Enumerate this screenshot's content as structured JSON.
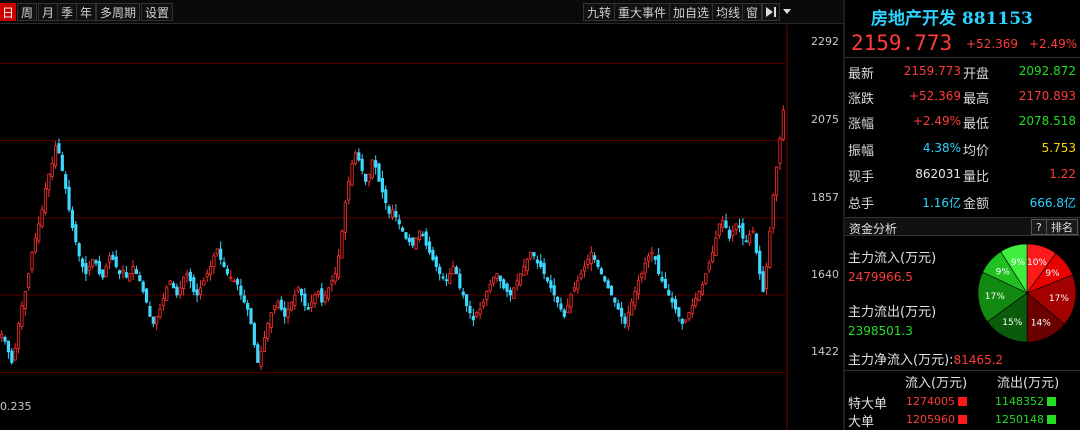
{
  "toolbar": {
    "left": [
      "日",
      "周",
      "月",
      "季",
      "年",
      "多周期",
      "设置"
    ],
    "right": [
      "九转",
      "重大事件",
      "加自选",
      "均线",
      "窗"
    ]
  },
  "chart": {
    "y_labels": [
      "2292",
      "2075",
      "1857",
      "1640",
      "1422"
    ],
    "min_label": "0.235"
  },
  "chart_data": {
    "type": "candlestick",
    "ylim": [
      1260,
      2400
    ],
    "closes": [
      1530,
      1510,
      1480,
      1450,
      1490,
      1560,
      1610,
      1650,
      1700,
      1760,
      1800,
      1840,
      1880,
      1940,
      1980,
      2010,
      2060,
      2040,
      1990,
      1940,
      1880,
      1830,
      1790,
      1750,
      1720,
      1700,
      1720,
      1740,
      1730,
      1700,
      1690,
      1720,
      1750,
      1740,
      1720,
      1700,
      1710,
      1690,
      1700,
      1720,
      1700,
      1680,
      1650,
      1620,
      1580,
      1560,
      1580,
      1600,
      1630,
      1660,
      1680,
      1660,
      1640,
      1660,
      1690,
      1700,
      1680,
      1650,
      1640,
      1660,
      1680,
      1700,
      1720,
      1750,
      1770,
      1740,
      1720,
      1700,
      1690,
      1680,
      1670,
      1640,
      1620,
      1600,
      1560,
      1500,
      1450,
      1480,
      1520,
      1560,
      1590,
      1610,
      1620,
      1600,
      1580,
      1600,
      1620,
      1640,
      1660,
      1640,
      1610,
      1600,
      1620,
      1640,
      1650,
      1620,
      1640,
      1660,
      1680,
      1700,
      1750,
      1820,
      1900,
      1960,
      2010,
      2040,
      2020,
      1990,
      1960,
      1980,
      2020,
      2000,
      1960,
      1930,
      1900,
      1870,
      1880,
      1860,
      1840,
      1820,
      1800,
      1790,
      1780,
      1800,
      1820,
      1810,
      1780,
      1760,
      1740,
      1720,
      1700,
      1690,
      1680,
      1700,
      1720,
      1700,
      1660,
      1640,
      1610,
      1590,
      1570,
      1590,
      1600,
      1620,
      1650,
      1670,
      1690,
      1700,
      1680,
      1660,
      1650,
      1640,
      1660,
      1680,
      1700,
      1720,
      1740,
      1760,
      1750,
      1730,
      1720,
      1700,
      1680,
      1660,
      1640,
      1620,
      1600,
      1580,
      1610,
      1640,
      1660,
      1680,
      1700,
      1720,
      1740,
      1760,
      1740,
      1720,
      1700,
      1680,
      1660,
      1640,
      1620,
      1600,
      1580,
      1560,
      1590,
      1620,
      1650,
      1680,
      1700,
      1730,
      1750,
      1760,
      1740,
      1700,
      1680,
      1660,
      1640,
      1620,
      1600,
      1580,
      1560,
      1570,
      1590,
      1610,
      1630,
      1650,
      1670,
      1700,
      1730,
      1760,
      1800,
      1840,
      1850,
      1830,
      1800,
      1820,
      1840,
      1830,
      1800,
      1790,
      1810,
      1820,
      1760,
      1700,
      1650,
      1720,
      1820,
      1920,
      2000,
      2080,
      2160
    ]
  },
  "panel": {
    "name": "房地产开发 881153",
    "price": "2159.773",
    "change": "+52.369",
    "change_pct": "+2.49%",
    "quote": [
      {
        "l1": "最新",
        "v1": "2159.773",
        "c1": "red",
        "l2": "开盘",
        "v2": "2092.872",
        "c2": "green"
      },
      {
        "l1": "涨跌",
        "v1": "+52.369",
        "c1": "red",
        "l2": "最高",
        "v2": "2170.893",
        "c2": "red"
      },
      {
        "l1": "涨幅",
        "v1": "+2.49%",
        "c1": "red",
        "l2": "最低",
        "v2": "2078.518",
        "c2": "green"
      },
      {
        "l1": "振幅",
        "v1": "4.38%",
        "c1": "cyan",
        "l2": "均价",
        "v2": "5.753",
        "c2": "yellow"
      },
      {
        "l1": "现手",
        "v1": "862031",
        "c1": "white",
        "l2": "量比",
        "v2": "1.22",
        "c2": "red"
      },
      {
        "l1": "总手",
        "v1": "1.16亿",
        "c1": "cyan",
        "l2": "金额",
        "v2": "666.8亿",
        "c2": "cyan"
      }
    ],
    "fund": {
      "title": "资金分析",
      "help": "?",
      "rank": "排名",
      "inflow_label": "主力流入(万元)",
      "inflow_value": "2479966.5",
      "outflow_label": "主力流出(万元)",
      "outflow_value": "2398501.3",
      "net_label": "主力净流入(万元):",
      "net_value": "81465.2"
    },
    "pie": [
      {
        "pct": 10,
        "label": "10%",
        "color": "#ff1a1a"
      },
      {
        "pct": 9,
        "label": "9%",
        "color": "#e60000"
      },
      {
        "pct": 17,
        "label": "17%",
        "color": "#a30000"
      },
      {
        "pct": 14,
        "label": "14%",
        "color": "#6b0000"
      },
      {
        "pct": 15,
        "label": "15%",
        "color": "#0a5c0a"
      },
      {
        "pct": 17,
        "label": "17%",
        "color": "#128a12"
      },
      {
        "pct": 9,
        "label": "9%",
        "color": "#20c020"
      },
      {
        "pct": 9,
        "label": "9%",
        "color": "#40ee40"
      }
    ],
    "table": {
      "h_in": "流入(万元)",
      "h_out": "流出(万元)",
      "rows": [
        {
          "label": "特大单",
          "in": "1274005",
          "out": "1148352"
        },
        {
          "label": "大单",
          "in": "1205960",
          "out": "1250148"
        }
      ]
    }
  }
}
